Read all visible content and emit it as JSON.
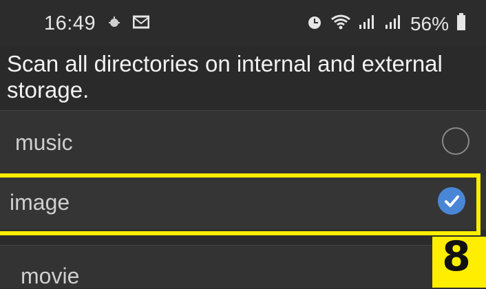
{
  "status": {
    "time": "16:49",
    "battery": "56%",
    "icons_left": [
      "bug-icon",
      "mail-icon"
    ],
    "icons_right": [
      "alarm-icon",
      "wifi-icon",
      "signal-icon",
      "signal-icon",
      "battery-icon"
    ]
  },
  "header": {
    "text": "Scan all directories on internal and external storage."
  },
  "list": {
    "items": [
      {
        "label": "music",
        "checked": false
      },
      {
        "label": "image",
        "checked": true
      },
      {
        "label": "movie",
        "checked": false
      }
    ]
  },
  "annotation": {
    "badge": "8",
    "highlight_color": "#ffee00"
  },
  "colors": {
    "accent": "#4a86d6"
  }
}
